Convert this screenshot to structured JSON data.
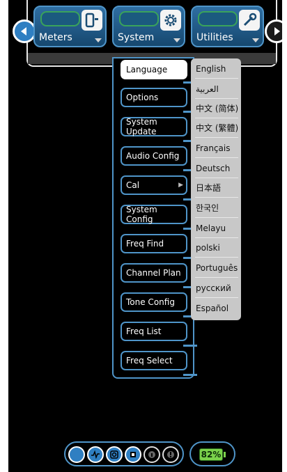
{
  "tabs": [
    {
      "label": "Meters",
      "icon": "meter-icon"
    },
    {
      "label": "System",
      "icon": "gear-icon"
    },
    {
      "label": "Utilities",
      "icon": "wrench-icon"
    }
  ],
  "menu": {
    "items": [
      {
        "label": "Language",
        "selected": true
      },
      {
        "label": "Options"
      },
      {
        "label": "System Update"
      },
      {
        "label": "Audio Config"
      },
      {
        "label": "Cal",
        "submenu_indicator": "▶"
      },
      {
        "label": "System Config"
      },
      {
        "label": "Freq Find"
      },
      {
        "label": "Channel Plan"
      },
      {
        "label": "Tone Config"
      },
      {
        "label": "Freq List"
      },
      {
        "label": "Freq Select"
      }
    ]
  },
  "languages": [
    "English",
    "العربية",
    "中文 (简体)",
    "中文 (繁體)",
    "Français",
    "Deutsch",
    "日本語",
    "한국인",
    "Melayu",
    "polski",
    "Português",
    "русский",
    "Español"
  ],
  "status": {
    "buttons": [
      "circle-icon",
      "waveform-icon",
      "camera-icon",
      "record-icon",
      "lock-icon",
      "alert-icon"
    ],
    "battery_text": "82%",
    "battery_level_percent": 82
  },
  "colors": {
    "accent": "#4f95c9",
    "battery": "#7bd24b"
  }
}
